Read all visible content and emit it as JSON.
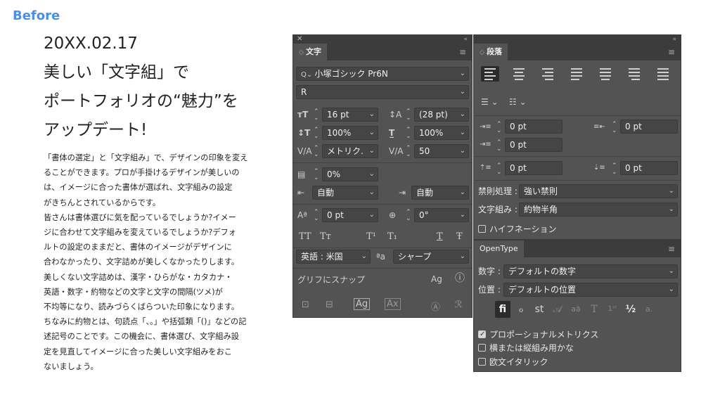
{
  "before_label": "Before",
  "headline": [
    "20XX.02.17",
    "美しい「文字組」で",
    "ポートフォリオの“魅力”を",
    "アップデート!"
  ],
  "body_lines": [
    "「書体の選定」と「文字組み」で、デザインの印象を変え",
    "ることができます。プロが手掛けるデザインが美しいの",
    "は、イメージに合った書体が選ばれ、文字組みの設定",
    "がきちんとされているからです。",
    "皆さんは書体選びに気を配っているでしょうか?イメー",
    "ジに合わせて文字組みを変えているでしょうか?デフォ",
    "ルトの設定のままだと、書体のイメージがデザインに",
    "合わなかったり、文字詰めが美しくなかったりします。",
    "美しくない文字詰めは、漢字・ひらがな・カタカナ・",
    "英語・数字・約物などの文字と文字の間隔(ツメ)が",
    "不均等になり、読みづらくばらついた印象になります。",
    "ちなみに約物とは、句読点「、。」や括弧類「()」などの記",
    "述記号のことです。この機会に、書体選び、文字組み設",
    "定を見直してイメージに合った美しい文字組みをおこ",
    "ないましょう。"
  ],
  "character_panel": {
    "tab": "文字",
    "font_family": "小塚ゴシック Pr6N",
    "font_style": "R",
    "font_size": "16 pt",
    "leading": "(28 pt)",
    "vertical_scale": "100%",
    "horizontal_scale": "100%",
    "kerning": "メトリク.",
    "tracking": "50",
    "tsume": "0%",
    "aki_before": "自動",
    "aki_after": "自動",
    "baseline_shift": "0 pt",
    "rotation": "0°",
    "case_buttons": [
      "TT",
      "Tт",
      "T¹",
      "T₁",
      "T",
      "Ŧ"
    ],
    "language": "英語 : 米国",
    "aa_label": "ªa",
    "antialias": "シャープ",
    "snap_label": "グリフにスナップ"
  },
  "paragraph_panel": {
    "tab": "段落",
    "left_indent": "0 pt",
    "right_indent": "0 pt",
    "first_line_indent": "0 pt",
    "space_before": "0 pt",
    "space_after": "0 pt",
    "kinsoku_label": "禁則処理 :",
    "kinsoku_value": "強い禁則",
    "mojikumi_label": "文字組み :",
    "mojikumi_value": "約物半角",
    "hyphenation": "ハイフネーション"
  },
  "opentype_panel": {
    "tab": "OpenType",
    "figure_label": "数字 :",
    "figure_value": "デフォルトの数字",
    "position_label": "位置 :",
    "position_value": "デフォルトの位置",
    "glyph_buttons": [
      "fi",
      "ℴ",
      "st",
      "𝒜",
      "aā",
      "T",
      "1ˢᵗ",
      "½",
      "a."
    ],
    "proportional_metrics": "プロポーショナルメトリクス",
    "vertical_kana": "横または縦組み用かな",
    "roman_italic": "欧文イタリック"
  }
}
